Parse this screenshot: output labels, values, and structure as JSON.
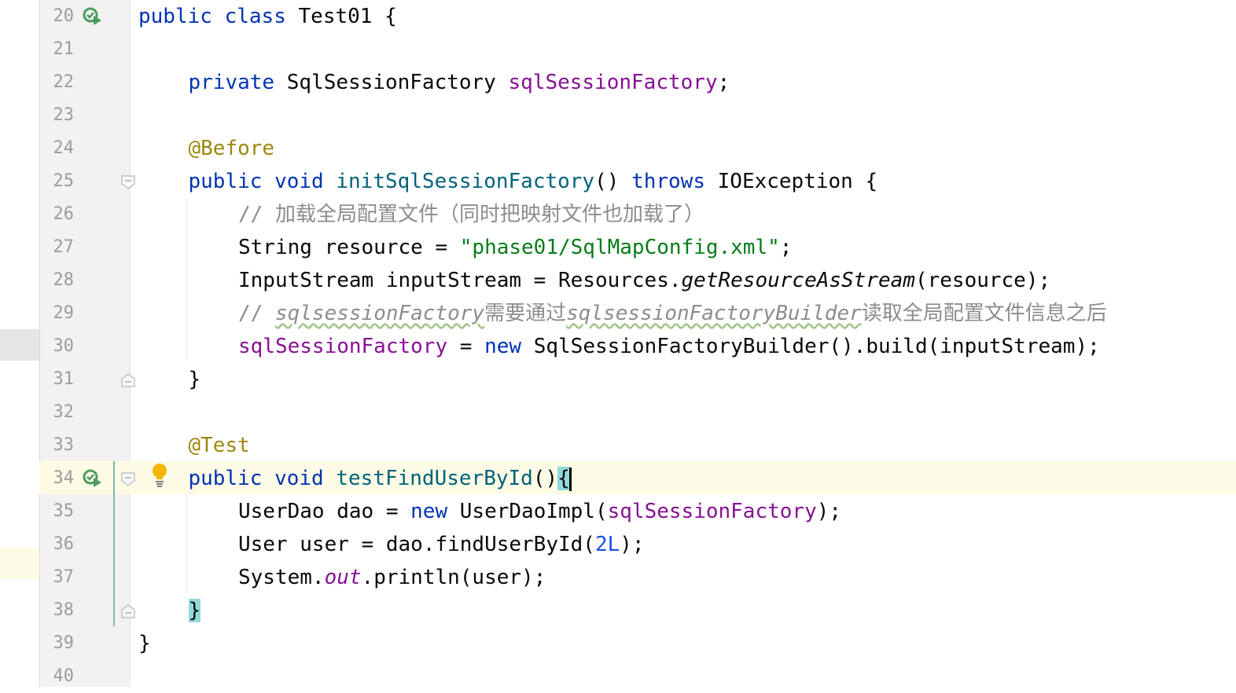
{
  "editor": {
    "lines": [
      {
        "num": "20",
        "tokens": [
          {
            "t": "public",
            "c": "kw"
          },
          {
            "t": " "
          },
          {
            "t": "class",
            "c": "kw"
          },
          {
            "t": " Test01 {"
          }
        ],
        "indent": 0,
        "run_icon": true
      },
      {
        "num": "21",
        "tokens": [],
        "indent": 0
      },
      {
        "num": "22",
        "tokens": [
          {
            "t": "private",
            "c": "kw"
          },
          {
            "t": " SqlSessionFactory "
          },
          {
            "t": "sqlSessionFactory",
            "c": "fld"
          },
          {
            "t": ";"
          }
        ],
        "indent": 1
      },
      {
        "num": "23",
        "tokens": [],
        "indent": 0
      },
      {
        "num": "24",
        "tokens": [
          {
            "t": "@Before",
            "c": "ann"
          }
        ],
        "indent": 1
      },
      {
        "num": "25",
        "tokens": [
          {
            "t": "public",
            "c": "kw"
          },
          {
            "t": " "
          },
          {
            "t": "void",
            "c": "kw"
          },
          {
            "t": " "
          },
          {
            "t": "initSqlSessionFactory",
            "c": "fn"
          },
          {
            "t": "() "
          },
          {
            "t": "throws",
            "c": "kw"
          },
          {
            "t": " IOException {"
          }
        ],
        "indent": 1,
        "fold": "open"
      },
      {
        "num": "26",
        "tokens": [
          {
            "t": "// 加载全局配置文件（同时把映射文件也加载了）",
            "c": "cmt"
          }
        ],
        "indent": 2
      },
      {
        "num": "27",
        "tokens": [
          {
            "t": "String resource = "
          },
          {
            "t": "\"phase01/SqlMapConfig.xml\"",
            "c": "str"
          },
          {
            "t": ";"
          }
        ],
        "indent": 2
      },
      {
        "num": "28",
        "tokens": [
          {
            "t": "InputStream inputStream = Resources."
          },
          {
            "t": "getResourceAsStream",
            "c": "it"
          },
          {
            "t": "(resource);"
          }
        ],
        "indent": 2
      },
      {
        "num": "29",
        "tokens": [
          {
            "t": "// ",
            "c": "cmt"
          },
          {
            "t": "sqlsessionFactory",
            "c": "cmt it wavy"
          },
          {
            "t": "需要通过",
            "c": "cmt"
          },
          {
            "t": "sqlsessionFactoryBuilder",
            "c": "cmt it wavy"
          },
          {
            "t": "读取全局配置文件信息之后",
            "c": "cmt"
          }
        ],
        "indent": 2
      },
      {
        "num": "30",
        "tokens": [
          {
            "t": "sqlSessionFactory",
            "c": "fld"
          },
          {
            "t": " = "
          },
          {
            "t": "new",
            "c": "kw"
          },
          {
            "t": " SqlSessionFactoryBuilder().build(inputStream);"
          }
        ],
        "indent": 2
      },
      {
        "num": "31",
        "tokens": [
          {
            "t": "}"
          }
        ],
        "indent": 1,
        "fold": "close"
      },
      {
        "num": "32",
        "tokens": [],
        "indent": 0
      },
      {
        "num": "33",
        "tokens": [
          {
            "t": "@Test",
            "c": "ann"
          }
        ],
        "indent": 1
      },
      {
        "num": "34",
        "tokens": [
          {
            "t": "public",
            "c": "kw"
          },
          {
            "t": " "
          },
          {
            "t": "void",
            "c": "kw"
          },
          {
            "t": " "
          },
          {
            "t": "testFindUserById",
            "c": "fn"
          },
          {
            "t": "()"
          },
          {
            "t": "{",
            "c": "brace-hl"
          },
          {
            "caret": true
          }
        ],
        "indent": 1,
        "run_icon": true,
        "fold": "open",
        "bulb": true,
        "current": true
      },
      {
        "num": "35",
        "tokens": [
          {
            "t": "UserDao dao = "
          },
          {
            "t": "new",
            "c": "kw"
          },
          {
            "t": " UserDaoImpl("
          },
          {
            "t": "sqlSessionFactory",
            "c": "fld"
          },
          {
            "t": ");"
          }
        ],
        "indent": 2
      },
      {
        "num": "36",
        "tokens": [
          {
            "t": "User user = dao.findUserById("
          },
          {
            "t": "2L",
            "c": "num"
          },
          {
            "t": ");"
          }
        ],
        "indent": 2
      },
      {
        "num": "37",
        "tokens": [
          {
            "t": "System."
          },
          {
            "t": "out",
            "c": "fld it"
          },
          {
            "t": ".println(user);"
          }
        ],
        "indent": 2
      },
      {
        "num": "38",
        "tokens": [
          {
            "t": "}",
            "c": "brace-hl"
          }
        ],
        "indent": 1,
        "fold": "close"
      },
      {
        "num": "39",
        "tokens": [
          {
            "t": "}"
          }
        ],
        "indent": 0
      },
      {
        "num": "40",
        "tokens": [],
        "indent": 0
      }
    ]
  },
  "icons": {
    "run": "run-test-icon",
    "fold_open": "fold-open-icon",
    "fold_close": "fold-close-icon",
    "bulb": "lightbulb-icon"
  },
  "colors": {
    "keyword": "#0033b3",
    "method": "#00627a",
    "field": "#871094",
    "annotation": "#9e880d",
    "string": "#067d17",
    "number": "#1750eb",
    "comment": "#8c8c8c",
    "brace_highlight": "#93d9d9",
    "current_line": "#fdfbe6"
  }
}
